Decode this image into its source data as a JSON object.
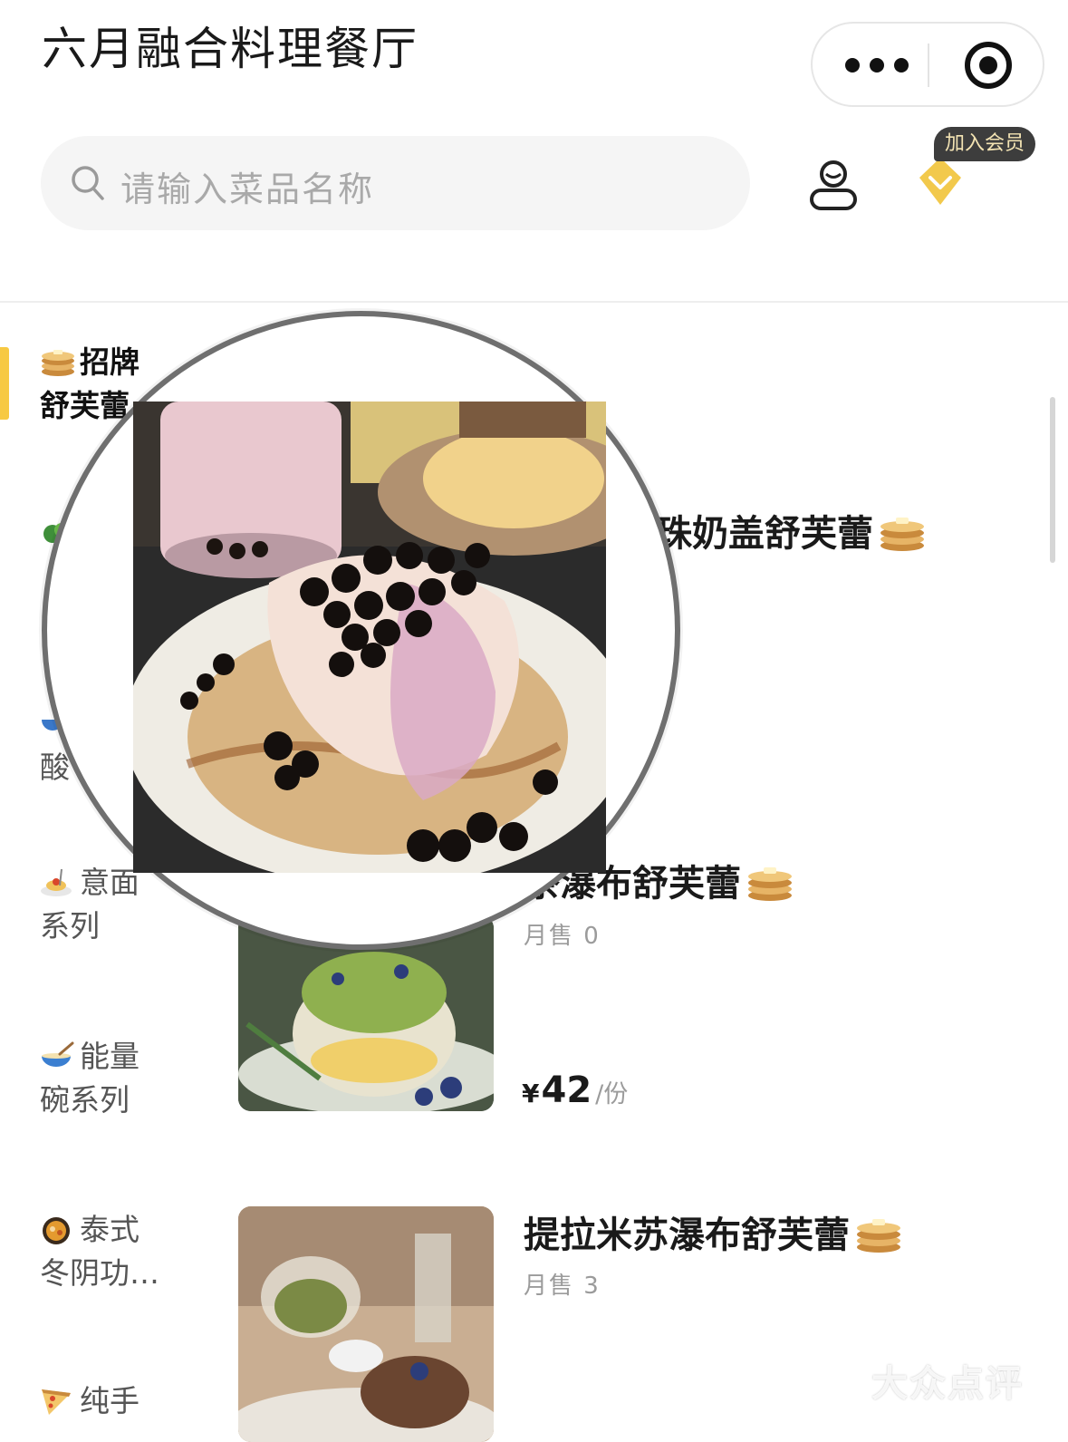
{
  "header": {
    "title": "六月融合料理餐厅"
  },
  "capsule": {
    "more_icon": "more-dots-icon",
    "close_icon": "target-icon"
  },
  "search": {
    "placeholder": "请输入菜品名称"
  },
  "member": {
    "badge": "加入会员"
  },
  "categories": [
    {
      "icon": "pancake-emoji",
      "label_line1": "招牌",
      "label_line2": "舒芙蕾",
      "active": true
    },
    {
      "icon": "salad-emoji",
      "label_line1": "",
      "label_line2": ""
    },
    {
      "icon": "bowl-emoji",
      "label_line1": "",
      "label_line2": "酸"
    },
    {
      "icon": "spaghetti-emoji",
      "label_line1": "意面",
      "label_line2": "系列"
    },
    {
      "icon": "bowl-spoon-emoji",
      "label_line1": "能量",
      "label_line2": "碗系列"
    },
    {
      "icon": "curry-emoji",
      "label_line1": "泰式",
      "label_line2": "冬阴功…"
    },
    {
      "icon": "pizza-emoji",
      "label_line1": "纯手",
      "label_line2": ""
    }
  ],
  "dishes": [
    {
      "name": "珠奶盖舒芙蕾",
      "sales": "",
      "price": ""
    },
    {
      "name": "茶瀑布舒芙蕾",
      "sales": "月售 0",
      "price_currency": "¥",
      "price": "42",
      "unit": "/份"
    },
    {
      "name": "提拉米苏瀑布舒芙蕾",
      "sales": "月售 3",
      "price": ""
    }
  ],
  "watermark": {
    "text": "大众点评"
  },
  "colors": {
    "accent": "#f7c942",
    "badge_bg": "#3d3d3d",
    "badge_text": "#f3e3b3",
    "diamond": "#f2c94c"
  }
}
